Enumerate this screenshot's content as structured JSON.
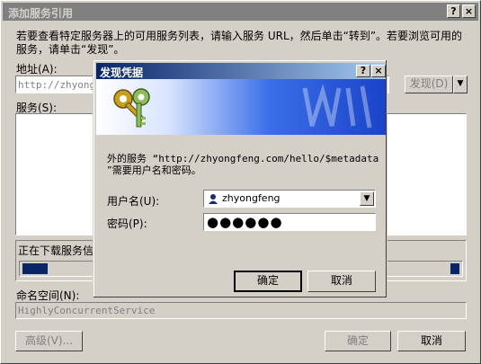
{
  "outer": {
    "title": "添加服务引用",
    "help_btn": "?",
    "close_btn": "×",
    "instructions": "若要查看特定服务器上的可用服务列表，请输入服务 URL，然后单击“转到”。若要浏览可用的服务，请单击“发现”。",
    "address_label": "地址(A):",
    "address_value": "http://zhyongf",
    "discover_btn": "发现(D)",
    "services_label": "服务(S):",
    "downloading_text": "正在下载服务信息",
    "namespace_label": "命名空间(N):",
    "namespace_value": "HighlyConcurrentService",
    "advanced_btn": "高级(V)...",
    "ok_btn": "确定",
    "cancel_btn": "取消",
    "progress_level": 0.12
  },
  "dialog": {
    "title": "发现凭据",
    "help_btn": "?",
    "close_btn": "×",
    "message_line1": "外的服务 “http://zhyongfeng.com/hello/$metadata",
    "message_line2": "”需要用户名和密码。",
    "username_label": "用户名(U):",
    "username_value": "zhyongfeng",
    "password_label": "密码(P):",
    "password_value": "●●●●●●",
    "ok_btn": "确定",
    "cancel_btn": "取消"
  },
  "icons": [
    "keys-icon",
    "user-icon",
    "dropdown-arrow-icon"
  ],
  "colors": {
    "title_active": "#0a246a",
    "title_inactive": "#808080",
    "progress": "#0a246a"
  }
}
